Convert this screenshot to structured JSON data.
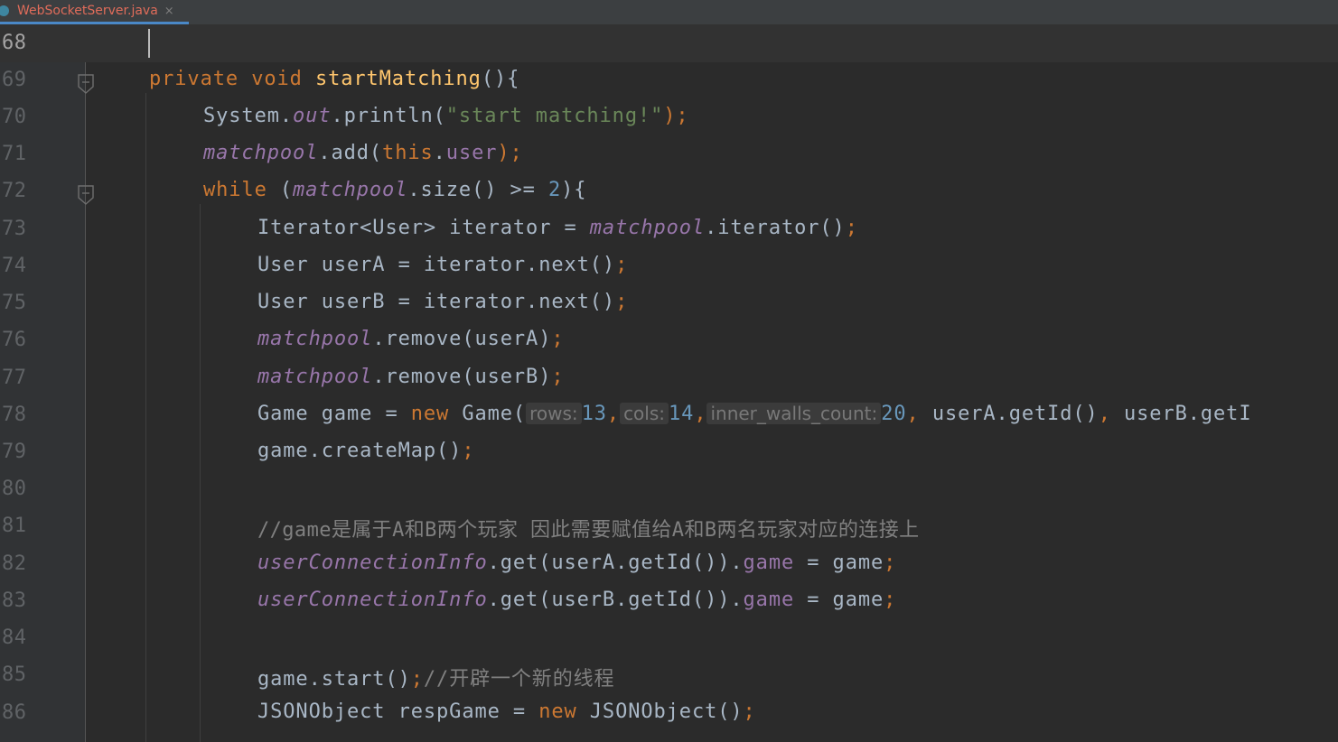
{
  "tab": {
    "filename": "WebSocketServer.java",
    "close": "×",
    "icon": "java-class-icon"
  },
  "colors": {
    "keyword": "#cc7832",
    "method": "#ffc66d",
    "string": "#6a8759",
    "number": "#6897bb",
    "field": "#9876aa",
    "comment": "#808080",
    "text": "#a9b7c6"
  },
  "lines": [
    {
      "n": "68"
    },
    {
      "n": "69",
      "t": [
        "private",
        "void",
        "startMatching",
        "(){"
      ]
    },
    {
      "n": "70",
      "t": [
        "System.",
        "out",
        ".println(",
        "\"start matching!\"",
        ");"
      ]
    },
    {
      "n": "71",
      "t": [
        "matchpool",
        ".add(",
        "this",
        ".",
        "user",
        ");"
      ]
    },
    {
      "n": "72",
      "t": [
        "while",
        " (",
        "matchpool",
        ".size() >= ",
        "2",
        "){"
      ]
    },
    {
      "n": "73",
      "t": [
        "Iterator<User> iterator = ",
        "matchpool",
        ".iterator()",
        ";"
      ]
    },
    {
      "n": "74",
      "t": [
        "User userA = iterator.next()",
        ";"
      ]
    },
    {
      "n": "75",
      "t": [
        "User userB = iterator.next()",
        ";"
      ]
    },
    {
      "n": "76",
      "t": [
        "matchpool",
        ".remove(userA)",
        ";"
      ]
    },
    {
      "n": "77",
      "t": [
        "matchpool",
        ".remove(userB)",
        ";"
      ]
    },
    {
      "n": "78",
      "t": [
        "Game game = ",
        "new",
        " Game(",
        "rows:",
        "13",
        ",",
        "cols:",
        "14",
        ",",
        "inner_walls_count:",
        "20",
        ",",
        " userA.getId()",
        ",",
        " userB.getI"
      ]
    },
    {
      "n": "79",
      "t": [
        "game.createMap()",
        ";"
      ]
    },
    {
      "n": "80"
    },
    {
      "n": "81",
      "t": [
        "//game是属于A和B两个玩家 因此需要赋值给A和B两名玩家对应的连接上"
      ]
    },
    {
      "n": "82",
      "t": [
        "userConnectionInfo",
        ".get(userA.getId()).",
        "game",
        " = game",
        ";"
      ]
    },
    {
      "n": "83",
      "t": [
        "userConnectionInfo",
        ".get(userB.getId()).",
        "game",
        " = game",
        ";"
      ]
    },
    {
      "n": "84"
    },
    {
      "n": "85",
      "t": [
        "game.start()",
        ";",
        "//开辟一个新的线程"
      ]
    },
    {
      "n": "86",
      "t": [
        "JSONObject respGame = ",
        "new",
        " JSONObject()",
        ";"
      ]
    }
  ]
}
